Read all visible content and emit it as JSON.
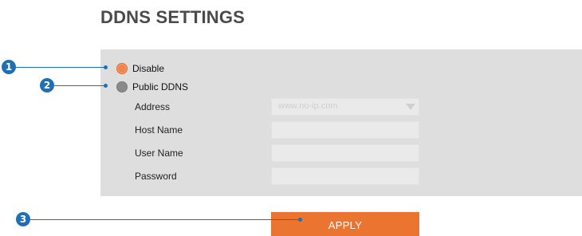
{
  "page": {
    "title": "DDNS SETTINGS"
  },
  "ddns": {
    "options": [
      {
        "label": "Disable",
        "selected": true
      },
      {
        "label": "Public DDNS",
        "selected": false
      }
    ],
    "fields": {
      "address": {
        "label": "Address",
        "value": "www.no-ip.com"
      },
      "host_name": {
        "label": "Host Name",
        "value": ""
      },
      "user_name": {
        "label": "User Name",
        "value": ""
      },
      "password": {
        "label": "Password",
        "value": ""
      }
    },
    "apply_label": "APPLY"
  },
  "callouts": [
    "1",
    "2",
    "3"
  ],
  "colors": {
    "accent": "#ec7431",
    "callout": "#1f6fb5",
    "panel": "#dedede"
  }
}
